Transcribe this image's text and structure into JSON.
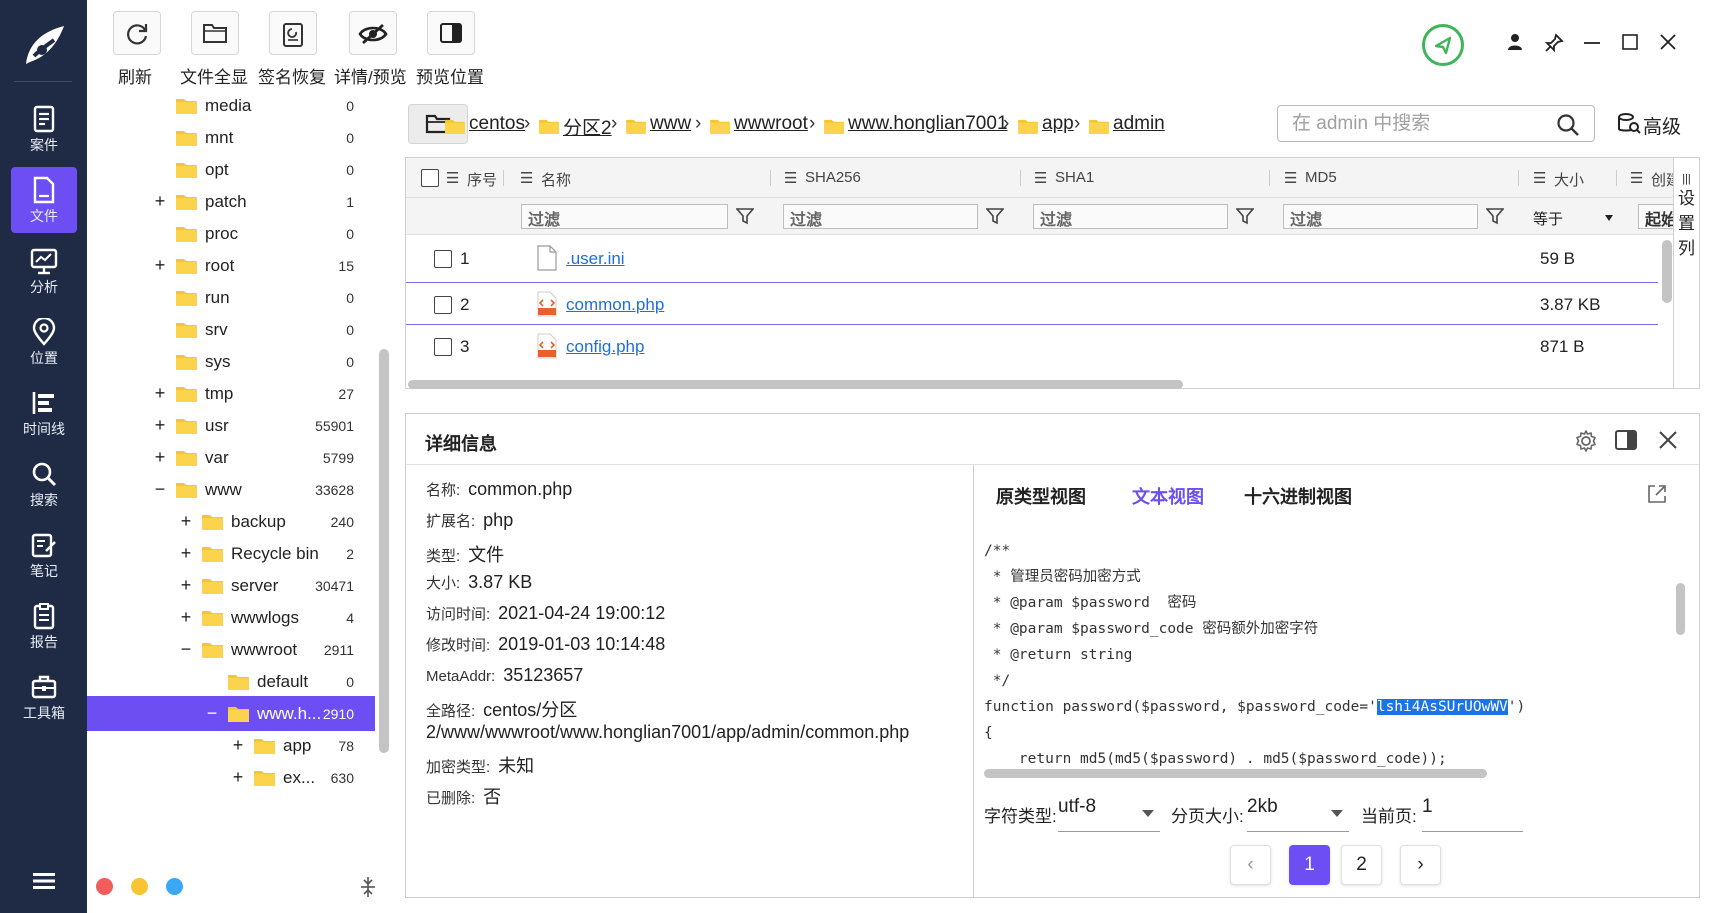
{
  "toolbar": {
    "refresh": "刷新",
    "file_all": "文件全显",
    "sig_restore": "签名恢复",
    "detail_preview": "详情/预览",
    "preview_pos": "预览位置"
  },
  "nav": {
    "case": "案件",
    "file": "文件",
    "analysis": "分析",
    "location": "位置",
    "timeline": "时间线",
    "search": "搜索",
    "notes": "笔记",
    "report": "报告",
    "toolbox": "工具箱"
  },
  "tree": [
    {
      "name": "media",
      "count": "0",
      "expand": ""
    },
    {
      "name": "mnt",
      "count": "0",
      "expand": ""
    },
    {
      "name": "opt",
      "count": "0",
      "expand": ""
    },
    {
      "name": "patch",
      "count": "1",
      "expand": "+"
    },
    {
      "name": "proc",
      "count": "0",
      "expand": ""
    },
    {
      "name": "root",
      "count": "15",
      "expand": "+"
    },
    {
      "name": "run",
      "count": "0",
      "expand": ""
    },
    {
      "name": "srv",
      "count": "0",
      "expand": ""
    },
    {
      "name": "sys",
      "count": "0",
      "expand": ""
    },
    {
      "name": "tmp",
      "count": "27",
      "expand": "+"
    },
    {
      "name": "usr",
      "count": "55901",
      "expand": "+"
    },
    {
      "name": "var",
      "count": "5799",
      "expand": "+"
    },
    {
      "name": "www",
      "count": "33628",
      "expand": "−"
    },
    {
      "name": "backup",
      "count": "240",
      "expand": "+"
    },
    {
      "name": "Recycle bin",
      "count": "2",
      "expand": "+"
    },
    {
      "name": "server",
      "count": "30471",
      "expand": "+"
    },
    {
      "name": "wwwlogs",
      "count": "4",
      "expand": "+"
    },
    {
      "name": "wwwroot",
      "count": "2911",
      "expand": "−"
    },
    {
      "name": "default",
      "count": "0",
      "expand": ""
    },
    {
      "name": "www.h...",
      "count": "2910",
      "expand": "−"
    },
    {
      "name": "app",
      "count": "78",
      "expand": "+"
    },
    {
      "name": "ex...",
      "count": "630",
      "expand": "+"
    }
  ],
  "breadcrumb": {
    "items": [
      "centos",
      "分区2",
      "www",
      "wwwroot",
      "www.honglian7001",
      "app",
      "admin"
    ],
    "sep": "›"
  },
  "search": {
    "placeholder": "在 admin 中搜索",
    "advanced": "高级"
  },
  "table": {
    "headers": {
      "seq": "序号",
      "name": "名称",
      "sha256": "SHA256",
      "sha1": "SHA1",
      "md5": "MD5",
      "size": "大小",
      "created": "创建"
    },
    "filter_placeholder": "过滤",
    "size_op": "等于",
    "start": "起始",
    "rows": [
      {
        "num": "1",
        "name": ".user.ini",
        "size": "59 B"
      },
      {
        "num": "2",
        "name": "common.php",
        "size": "3.87 KB"
      },
      {
        "num": "3",
        "name": "config.php",
        "size": "871 B"
      }
    ],
    "set_col": [
      "设",
      "置",
      "列"
    ]
  },
  "detail": {
    "title": "详细信息",
    "props": {
      "name_k": "名称:",
      "name_v": "common.php",
      "ext_k": "扩展名:",
      "ext_v": "php",
      "type_k": "类型:",
      "type_v": "文件",
      "size_k": "大小:",
      "size_v": "3.87 KB",
      "atime_k": "访问时间:",
      "atime_v": "2021-04-24 19:00:12",
      "mtime_k": "修改时间:",
      "mtime_v": "2019-01-03 10:14:48",
      "meta_k": "MetaAddr:",
      "meta_v": "35123657",
      "path_k": "全路径:",
      "path_v1": "centos/分区",
      "path_v2": "2/www/wwwroot/www.honglian7001/app/admin/common.php",
      "enc_k": "加密类型:",
      "enc_v": "未知",
      "del_k": "已删除:",
      "del_v": "否"
    },
    "tabs": {
      "original": "原类型视图",
      "text": "文本视图",
      "hex": "十六进制视图"
    },
    "code": {
      "l1": "/**",
      "l2": " * 管理员密码加密方式",
      "l3": " * @param $password  密码",
      "l4": " * @param $password_code 密码额外加密字符",
      "l5": " * @return string",
      "l6": " */",
      "l7a": "function password($password, $password_code='",
      "l7b": "lshi4AsSUrUOwWV",
      "l7c": "')",
      "l8": "{",
      "l9": "    return md5(md5($password) . md5($password_code));"
    },
    "options": {
      "charset_k": "字符类型:",
      "charset_v": "utf-8",
      "pagesize_k": "分页大小:",
      "pagesize_v": "2kb",
      "curpage_k": "当前页:",
      "curpage_v": "1"
    },
    "pages": [
      "1",
      "2"
    ]
  }
}
